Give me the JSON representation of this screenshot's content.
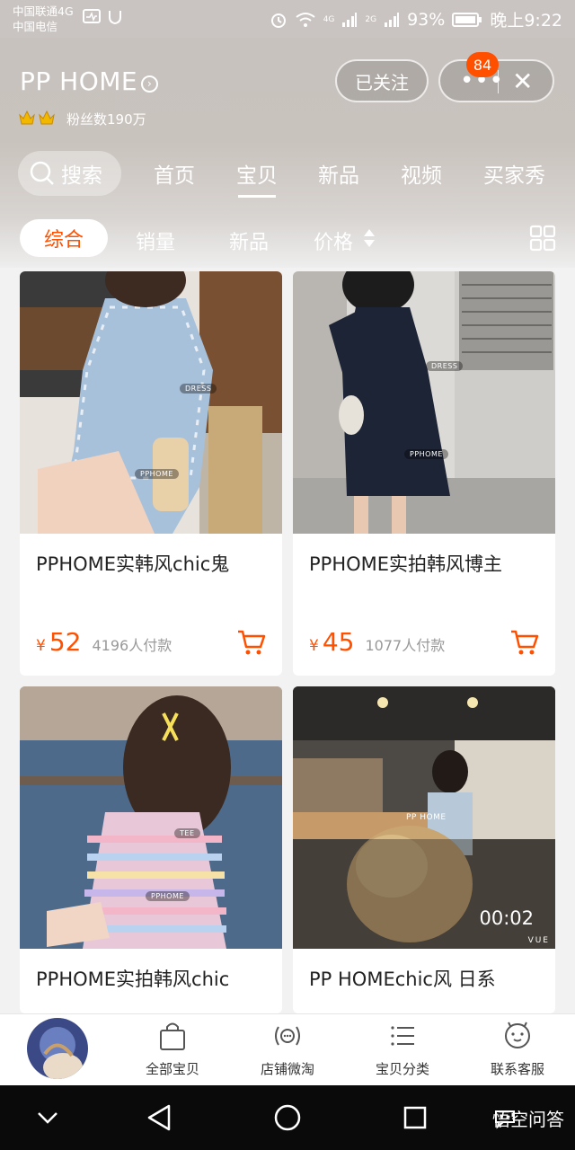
{
  "status_bar": {
    "carrier_1": "中国联通4G",
    "carrier_2": "中国电信",
    "network_1": "4G",
    "network_2": "2G",
    "battery": "93%",
    "time": "晚上9:22"
  },
  "shop": {
    "name": "PP HOME",
    "fans": "粉丝数190万",
    "follow_label": "已关注",
    "notification_count": "84"
  },
  "tabs": {
    "search_label": "搜索",
    "items": [
      "首页",
      "宝贝",
      "新品",
      "视频",
      "买家秀"
    ],
    "active": "宝贝"
  },
  "sort": {
    "items": [
      "综合",
      "销量",
      "新品",
      "价格"
    ],
    "active": "综合"
  },
  "products": [
    {
      "title": "PPHOME实韩风chic鬼",
      "price": "52",
      "currency": "¥",
      "sold": "4196人付款",
      "tags": [
        "DRESS",
        "PPHOME"
      ]
    },
    {
      "title": "PPHOME实拍韩风博主",
      "price": "45",
      "currency": "¥",
      "sold": "1077人付款",
      "tags": [
        "DRESS",
        "PPHOME"
      ]
    },
    {
      "title": "PPHOME实拍韩风chic",
      "tags": [
        "TEE",
        "PPHOME"
      ]
    },
    {
      "title": "PP HOMEchic风 日系",
      "video_time": "00:02",
      "overlay_text": "PP HOME",
      "watermark": "VUE"
    }
  ],
  "bottom_nav": {
    "items": [
      "全部宝贝",
      "店铺微淘",
      "宝贝分类",
      "联系客服"
    ]
  },
  "system_watermark": "悟空问答",
  "colors": {
    "accent": "#ff5000",
    "header_bg": "#c9c3bd",
    "system_nav": "#0a0a0a"
  }
}
